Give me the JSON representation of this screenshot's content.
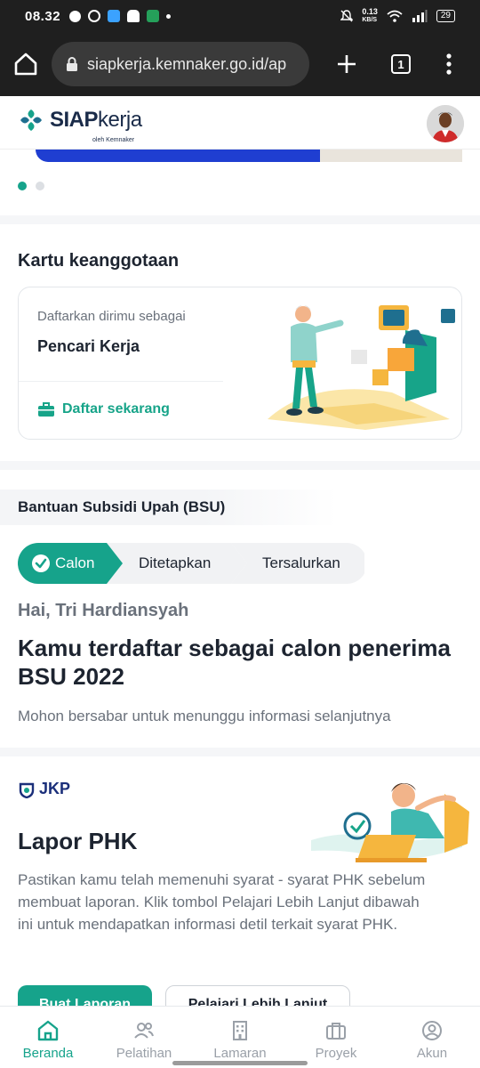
{
  "status_bar": {
    "time": "08.32",
    "net_speed": "0.13",
    "net_unit": "KB/S",
    "battery": "29"
  },
  "browser": {
    "url": "siapkerja.kemnaker.go.id/ap",
    "tab_count": "1"
  },
  "header": {
    "brand_bold": "SIAP",
    "brand_light": "kerja",
    "brand_sub": "oleh Kemnaker"
  },
  "membership": {
    "section_title": "Kartu keanggotaan",
    "prompt": "Daftarkan dirimu sebagai",
    "role": "Pencari Kerja",
    "cta_label": "Daftar sekarang"
  },
  "bsu": {
    "title": "Bantuan Subsidi Upah (BSU)",
    "steps": [
      {
        "label": "Calon",
        "state": "active"
      },
      {
        "label": "Ditetapkan",
        "state": "inactive"
      },
      {
        "label": "Tersalurkan",
        "state": "inactive"
      }
    ],
    "greeting": "Hai, Tri Hardiansyah",
    "headline": "Kamu terdaftar sebagai calon penerima BSU 2022",
    "note": "Mohon bersabar untuk menunggu informasi selanjutnya"
  },
  "jkp": {
    "logo_text": "JKP",
    "title": "Lapor PHK",
    "description": "Pastikan kamu telah memenuhi syarat - syarat PHK sebelum membuat laporan. Klik tombol Pelajari Lebih Lanjut dibawah ini untuk mendapatkan informasi detil terkait syarat PHK.",
    "primary_button": "Buat Laporan",
    "secondary_button": "Pelajari Lebih Lanjut"
  },
  "bottom_nav": [
    {
      "label": "Beranda",
      "icon": "home-icon",
      "active": true
    },
    {
      "label": "Pelatihan",
      "icon": "people-icon",
      "active": false
    },
    {
      "label": "Lamaran",
      "icon": "building-icon",
      "active": false
    },
    {
      "label": "Proyek",
      "icon": "briefcase-icon",
      "active": false
    },
    {
      "label": "Akun",
      "icon": "account-icon",
      "active": false
    }
  ],
  "colors": {
    "accent": "#16a38b",
    "brand_navy": "#1a2b49",
    "banner_blue": "#1f3ed1"
  }
}
